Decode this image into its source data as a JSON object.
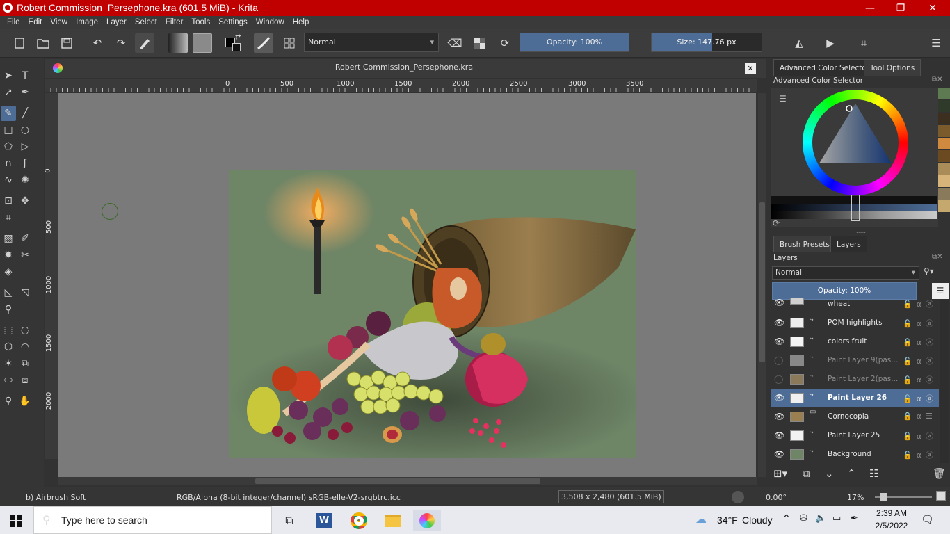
{
  "window": {
    "title": "Robert Commission_Persephone.kra (601.5 MiB)  - Krita",
    "minimize": "—",
    "restore": "❐",
    "close": "✕"
  },
  "menu": [
    "File",
    "Edit",
    "View",
    "Image",
    "Layer",
    "Select",
    "Filter",
    "Tools",
    "Settings",
    "Window",
    "Help"
  ],
  "toolbar": {
    "blend_mode": "Normal",
    "opacity_label": "Opacity: 100%",
    "opacity": 1.0,
    "size_label": "Size: 147.76 px",
    "size_fill": 0.55
  },
  "document": {
    "tab_title": "Robert Commission_Persephone.kra",
    "close": "✕",
    "hruler_labels": [
      "0",
      "500",
      "1000",
      "1500",
      "2000",
      "2500",
      "3000",
      "3500"
    ],
    "vruler_labels": [
      "0",
      "500",
      "1000",
      "1500",
      "2000"
    ]
  },
  "docker_top": {
    "tabs": [
      "Advanced Color Selector",
      "Tool Options"
    ],
    "title": "Advanced Color Selector",
    "swatches": [
      "#5e7a52",
      "#2f3a2a",
      "#3d2f1f",
      "#7b5a2c",
      "#d08a40",
      "#6b4a22",
      "#a98c58",
      "#d7b57a",
      "#8a7a5c",
      "#c5a86e"
    ]
  },
  "docker_layers": {
    "tabs": [
      "Brush Presets",
      "Layers"
    ],
    "title": "Layers",
    "blend_mode": "Normal",
    "opacity_label": "Opacity:  100%",
    "layers": [
      {
        "name": "wheat",
        "state": "normal"
      },
      {
        "name": "POM highlights",
        "state": "normal"
      },
      {
        "name": "colors fruit",
        "state": "normal"
      },
      {
        "name": "Paint Layer 9(pas...",
        "state": "hidden"
      },
      {
        "name": "Paint Layer 2(pas...",
        "state": "hidden"
      },
      {
        "name": "Paint Layer 26",
        "state": "selected"
      },
      {
        "name": "Cornocopia",
        "state": "group"
      },
      {
        "name": "Paint Layer 25",
        "state": "normal"
      },
      {
        "name": "Background",
        "state": "normal"
      }
    ]
  },
  "status": {
    "brush": "b) Airbrush Soft",
    "colorspace": "RGB/Alpha (8-bit integer/channel)  sRGB-elle-V2-srgbtrc.icc",
    "dimensions": "3,508 x 2,480 (601.5 MiB)",
    "rotation": "0.00°",
    "zoom": "17%"
  },
  "taskbar": {
    "search_placeholder": "Type here to search",
    "weather_temp": "34°F",
    "weather_desc": "Cloudy",
    "time": "2:39 AM",
    "date": "2/5/2022"
  }
}
